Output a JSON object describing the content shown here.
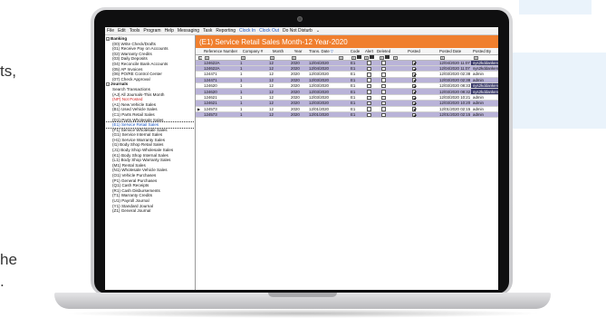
{
  "edge_text": [
    "ts,",
    "he",
    "."
  ],
  "menu": [
    {
      "label": "File",
      "color": "#111111"
    },
    {
      "label": "Edit",
      "color": "#111111"
    },
    {
      "label": "Tools",
      "color": "#111111"
    },
    {
      "label": "Program",
      "color": "#111111"
    },
    {
      "label": "Help",
      "color": "#111111"
    },
    {
      "label": "Messaging",
      "color": "#111111"
    },
    {
      "label": "Task",
      "color": "#111111"
    },
    {
      "label": "Reporting",
      "color": "#111111"
    },
    {
      "label": "Clock In",
      "color": "#1a56c4"
    },
    {
      "label": "Clock Out",
      "color": "#1a56c4"
    },
    {
      "label": "Do Not Disturb",
      "color": "#111111"
    }
  ],
  "tree": {
    "banking": {
      "label": "Banking",
      "items": [
        {
          "label": "(00) Write Check/Drafts",
          "style": ""
        },
        {
          "label": "(01) Receive Pay on Accounts",
          "style": ""
        },
        {
          "label": "(02) Warranty Credits",
          "style": ""
        },
        {
          "label": "(03) Daily Deposits",
          "style": ""
        },
        {
          "label": "(04) Reconcile Bank Accounts",
          "style": ""
        },
        {
          "label": "(05) AP Invoices",
          "style": ""
        },
        {
          "label": "(06) PO/RE Control Center",
          "style": ""
        },
        {
          "label": "(07) Check Approval",
          "style": ""
        }
      ]
    },
    "journals": {
      "label": "Journals",
      "items": [
        {
          "label": "Search Transactions",
          "style": ""
        },
        {
          "label": "(AJ) All Journals-This Month",
          "style": ""
        },
        {
          "label": "(NP) Not Posted",
          "style": "red"
        },
        {
          "label": "(A1) New Vehicle Sales",
          "style": ""
        },
        {
          "label": "(B1) Used Vehicle Sales",
          "style": ""
        },
        {
          "label": "(C1) Parts Retail Sales",
          "style": ""
        },
        {
          "label": "(D1) Parts Wholesale Sales",
          "style": ""
        },
        {
          "label": "(E1) Service Retail Sales",
          "style": "sel"
        },
        {
          "label": "(F1) Service Wholesale Sales",
          "style": ""
        },
        {
          "label": "(G1) Service Internal Sales",
          "style": ""
        },
        {
          "label": "(H1) Service Warranty Sales",
          "style": ""
        },
        {
          "label": "(I1) Body Shop Retail Sales",
          "style": ""
        },
        {
          "label": "(J1) Body Shop Wholesale Sales",
          "style": ""
        },
        {
          "label": "(K1) Body Shop Internal Sales",
          "style": ""
        },
        {
          "label": "(L1) Body Shop Warranty Sales",
          "style": ""
        },
        {
          "label": "(M1) Rental Sales",
          "style": ""
        },
        {
          "label": "(N1) Wholesale Vehicle Sales",
          "style": ""
        },
        {
          "label": "(O1) Vehicle Purchases",
          "style": ""
        },
        {
          "label": "(P1) General Purchases",
          "style": ""
        },
        {
          "label": "(Q1) Cash Receipts",
          "style": ""
        },
        {
          "label": "(R1) Cash Disbursements",
          "style": ""
        },
        {
          "label": "(T1) Warranty Credits",
          "style": ""
        },
        {
          "label": "(U1) Payroll Journal",
          "style": ""
        },
        {
          "label": "(Y1) Standard Journal",
          "style": ""
        },
        {
          "label": "(Z1) General Journal",
          "style": ""
        }
      ]
    }
  },
  "main": {
    "title": "(E1) Service Retail Sales Month-12 Year-2020",
    "columns": [
      "Reference Number",
      "Company #",
      "Month",
      "Year",
      "Trans. Date",
      "Code",
      "Alert",
      "Deleted",
      "Posted",
      "Posted Date",
      "Posted By"
    ],
    "rows": [
      {
        "ref": "124622A",
        "company": "1",
        "month": "12",
        "year": "2020",
        "date": "12/04/2020",
        "code": "E1",
        "alert": false,
        "deleted": false,
        "posted": true,
        "posted_date": "12/04/2020 11:07 AM",
        "posted_by": "sys2kddanken",
        "hl": true,
        "dark_by": true
      },
      {
        "ref": "124622A",
        "company": "1",
        "month": "12",
        "year": "2020",
        "date": "12/04/2020",
        "code": "E1",
        "alert": false,
        "deleted": false,
        "posted": true,
        "posted_date": "12/04/2020 11:07 AM",
        "posted_by": "sys2kddanken",
        "hl": true,
        "dark_by": false
      },
      {
        "ref": "124471",
        "company": "1",
        "month": "12",
        "year": "2020",
        "date": "12/03/2020",
        "code": "E1",
        "alert": false,
        "deleted": false,
        "posted": true,
        "posted_date": "12/03/2020 02:38 PM",
        "posted_by": "admin",
        "hl": false,
        "dark_by": false
      },
      {
        "ref": "124471",
        "company": "1",
        "month": "12",
        "year": "2020",
        "date": "12/03/2020",
        "code": "E1",
        "alert": false,
        "deleted": false,
        "posted": true,
        "posted_date": "12/03/2020 02:38 PM",
        "posted_by": "admin",
        "hl": true,
        "dark_by": false
      },
      {
        "ref": "124620",
        "company": "1",
        "month": "12",
        "year": "2020",
        "date": "12/03/2020",
        "code": "E1",
        "alert": false,
        "deleted": false,
        "posted": true,
        "posted_date": "12/03/2020 08:33 AM",
        "posted_by": "sys2kddanken",
        "hl": false,
        "dark_by": true
      },
      {
        "ref": "124620",
        "company": "1",
        "month": "12",
        "year": "2020",
        "date": "12/03/2020",
        "code": "E1",
        "alert": false,
        "deleted": false,
        "posted": true,
        "posted_date": "12/03/2020 08:32 AM",
        "posted_by": "sys2kddanken",
        "hl": true,
        "dark_by": true
      },
      {
        "ref": "124621",
        "company": "1",
        "month": "12",
        "year": "2020",
        "date": "12/03/2020",
        "code": "E1",
        "alert": false,
        "deleted": false,
        "posted": true,
        "posted_date": "12/03/2020 10:21 AM",
        "posted_by": "admin",
        "hl": false,
        "dark_by": false
      },
      {
        "ref": "124621",
        "company": "1",
        "month": "12",
        "year": "2020",
        "date": "12/03/2020",
        "code": "E1",
        "alert": false,
        "deleted": false,
        "posted": true,
        "posted_date": "12/03/2020 10:20 AM",
        "posted_by": "admin",
        "hl": true,
        "dark_by": false
      },
      {
        "ref": "124573",
        "company": "1",
        "month": "12",
        "year": "2020",
        "date": "12/01/2020",
        "code": "E1",
        "alert": false,
        "deleted": false,
        "posted": true,
        "posted_date": "12/01/2020 02:15 PM",
        "posted_by": "admin",
        "hl": false,
        "dark_by": false,
        "pointer": true
      },
      {
        "ref": "124573",
        "company": "1",
        "month": "12",
        "year": "2020",
        "date": "12/01/2020",
        "code": "E1",
        "alert": false,
        "deleted": false,
        "posted": true,
        "posted_date": "12/01/2020 02:15 PM",
        "posted_by": "admin",
        "hl": true,
        "dark_by": false
      }
    ]
  },
  "colors": {
    "title_bar": "#f07f2e",
    "row_highlight": "#b9b3d8",
    "posted_by_dark": "#3a3a6a",
    "menu_accent": "#1a56c4",
    "tree_alert": "#d21f1f"
  }
}
